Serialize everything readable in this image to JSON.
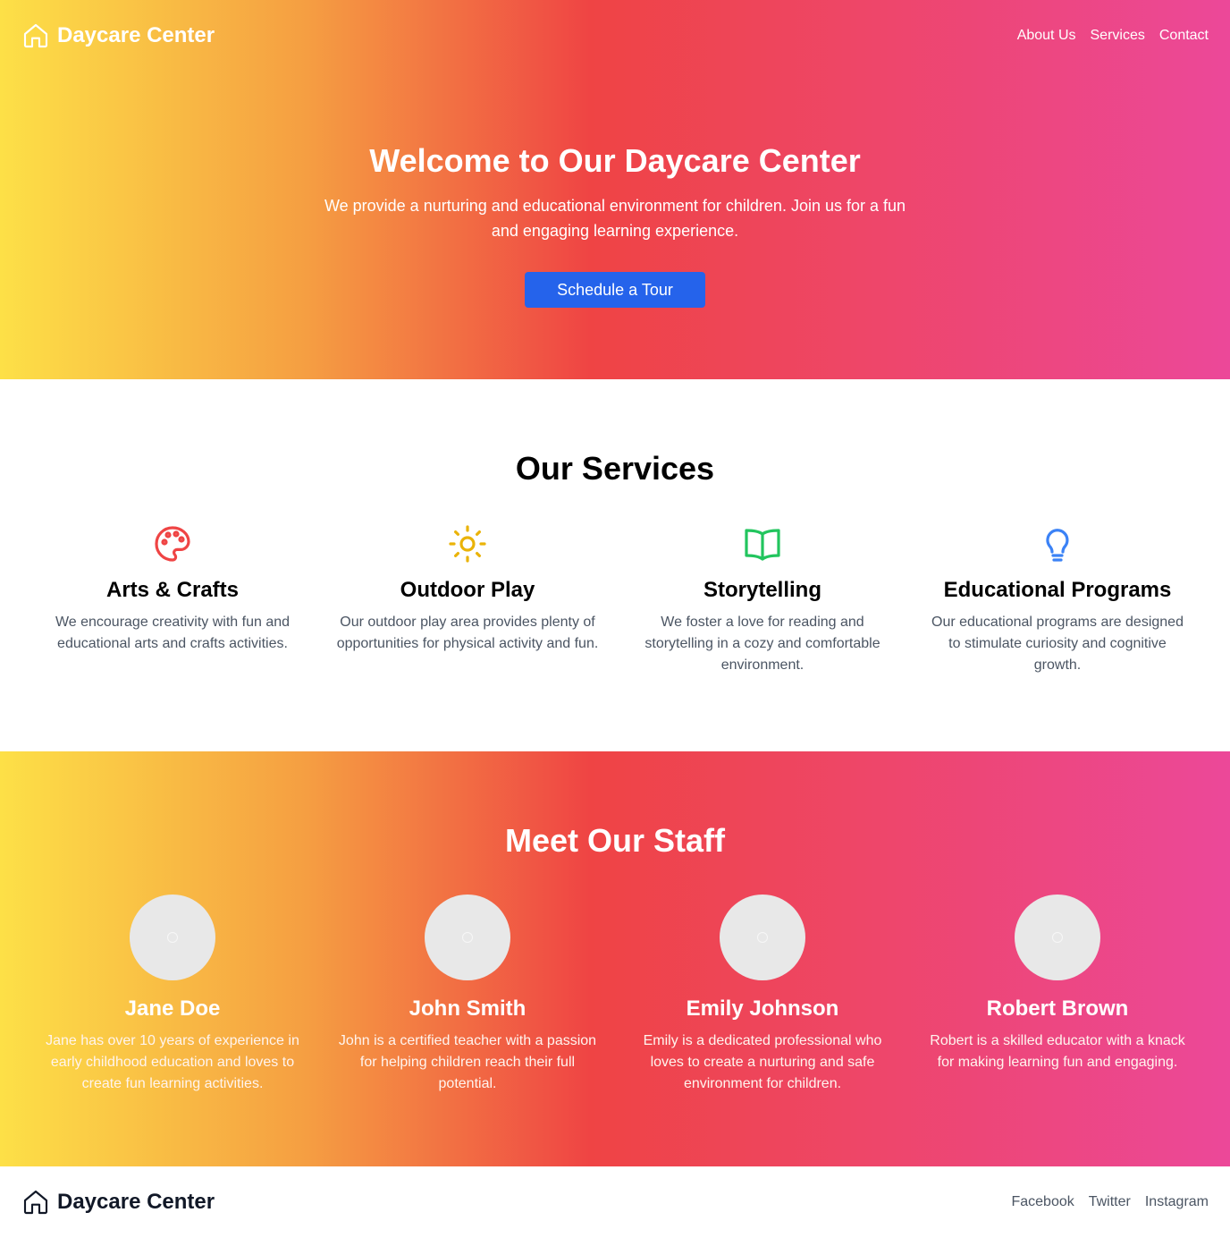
{
  "header": {
    "brand": "Daycare Center",
    "nav": [
      "About Us",
      "Services",
      "Contact"
    ]
  },
  "hero": {
    "title": "Welcome to Our Daycare Center",
    "text": "We provide a nurturing and educational environment for children. Join us for a fun and engaging learning experience.",
    "cta": "Schedule a Tour"
  },
  "services": {
    "title": "Our Services",
    "items": [
      {
        "icon": "palette-icon",
        "title": "Arts & Crafts",
        "desc": "We encourage creativity with fun and educational arts and crafts activities."
      },
      {
        "icon": "sun-icon",
        "title": "Outdoor Play",
        "desc": "Our outdoor play area provides plenty of opportunities for physical activity and fun."
      },
      {
        "icon": "book-open-icon",
        "title": "Storytelling",
        "desc": "We foster a love for reading and storytelling in a cozy and comfortable environment."
      },
      {
        "icon": "lightbulb-icon",
        "title": "Educational Programs",
        "desc": "Our educational programs are designed to stimulate curiosity and cognitive growth."
      }
    ]
  },
  "staff": {
    "title": "Meet Our Staff",
    "members": [
      {
        "name": "Jane Doe",
        "bio": "Jane has over 10 years of experience in early childhood education and loves to create fun learning activities."
      },
      {
        "name": "John Smith",
        "bio": "John is a certified teacher with a passion for helping children reach their full potential."
      },
      {
        "name": "Emily Johnson",
        "bio": "Emily is a dedicated professional who loves to create a nurturing and safe environment for children."
      },
      {
        "name": "Robert Brown",
        "bio": "Robert is a skilled educator with a knack for making learning fun and engaging."
      }
    ]
  },
  "footer": {
    "brand": "Daycare Center",
    "links": [
      "Facebook",
      "Twitter",
      "Instagram"
    ]
  },
  "colors": {
    "gradient": [
      "#fde047",
      "#f59e42",
      "#ef4444",
      "#ec4899"
    ],
    "cta": "#2563eb",
    "icons": [
      "#ef4444",
      "#eab308",
      "#22c55e",
      "#3b82f6"
    ]
  }
}
